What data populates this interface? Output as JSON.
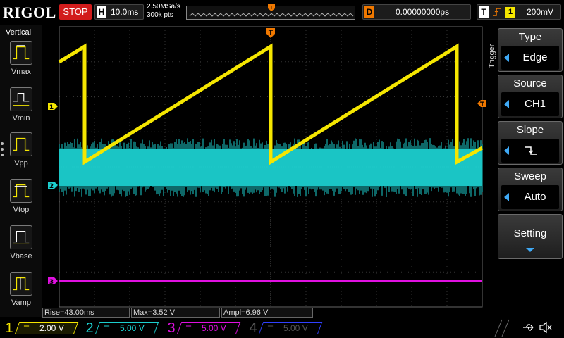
{
  "topbar": {
    "logo": "RIGOL",
    "run_status": "STOP",
    "timebase_tag": "H",
    "timebase": "10.0ms",
    "sample_rate": "2.50MSa/s",
    "memory_depth": "300k pts",
    "trigger_pos_tag": "T",
    "delay_tag": "D",
    "delay": "0.00000000ps",
    "trigger_tag": "T",
    "trigger_edge_icon": "rising-edge-icon",
    "trigger_source": "1",
    "trigger_level": "200mV"
  },
  "measure": {
    "title": "Vertical",
    "items": [
      {
        "label": "Vmax",
        "icon": "vmax-icon"
      },
      {
        "label": "Vmin",
        "icon": "vmin-icon"
      },
      {
        "label": "Vpp",
        "icon": "vpp-icon"
      },
      {
        "label": "Vtop",
        "icon": "vtop-icon"
      },
      {
        "label": "Vbase",
        "icon": "vbase-icon"
      },
      {
        "label": "Vamp",
        "icon": "vamp-icon"
      }
    ]
  },
  "screen": {
    "trigger_marker": "T",
    "ch1_marker": "1",
    "ch2_marker": "2",
    "ch3_marker": "3",
    "trigger_level_marker": "T"
  },
  "readouts": {
    "rise": "Rise=43.00ms",
    "max": "Max=3.52 V",
    "ampl": "Ampl=6.96 V"
  },
  "menu": {
    "title": "Trigger",
    "keys": [
      {
        "title": "Type",
        "value": "Edge"
      },
      {
        "title": "Source",
        "value": "CH1"
      },
      {
        "title": "Slope",
        "value": ""
      },
      {
        "title": "Sweep",
        "value": "Auto"
      },
      {
        "title": "Setting",
        "value": ""
      }
    ]
  },
  "channels": [
    {
      "num": "1",
      "coupling": "═",
      "scale": "2.00 V",
      "color": "#f5e600",
      "active": true
    },
    {
      "num": "2",
      "coupling": "═",
      "scale": "5.00 V",
      "color": "#1ccfcf",
      "active": false
    },
    {
      "num": "3",
      "coupling": "═",
      "scale": "5.00 V",
      "color": "#e010e0",
      "active": false
    },
    {
      "num": "4",
      "coupling": "═",
      "scale": "5.00 V",
      "color": "#3040ff",
      "active": false
    }
  ],
  "colors": {
    "ch1": "#f5e600",
    "ch2": "#1ccfcf",
    "ch3": "#e010e0",
    "ch4": "#3040ff",
    "trigger": "#f07800",
    "accent": "#3fa9f5"
  }
}
